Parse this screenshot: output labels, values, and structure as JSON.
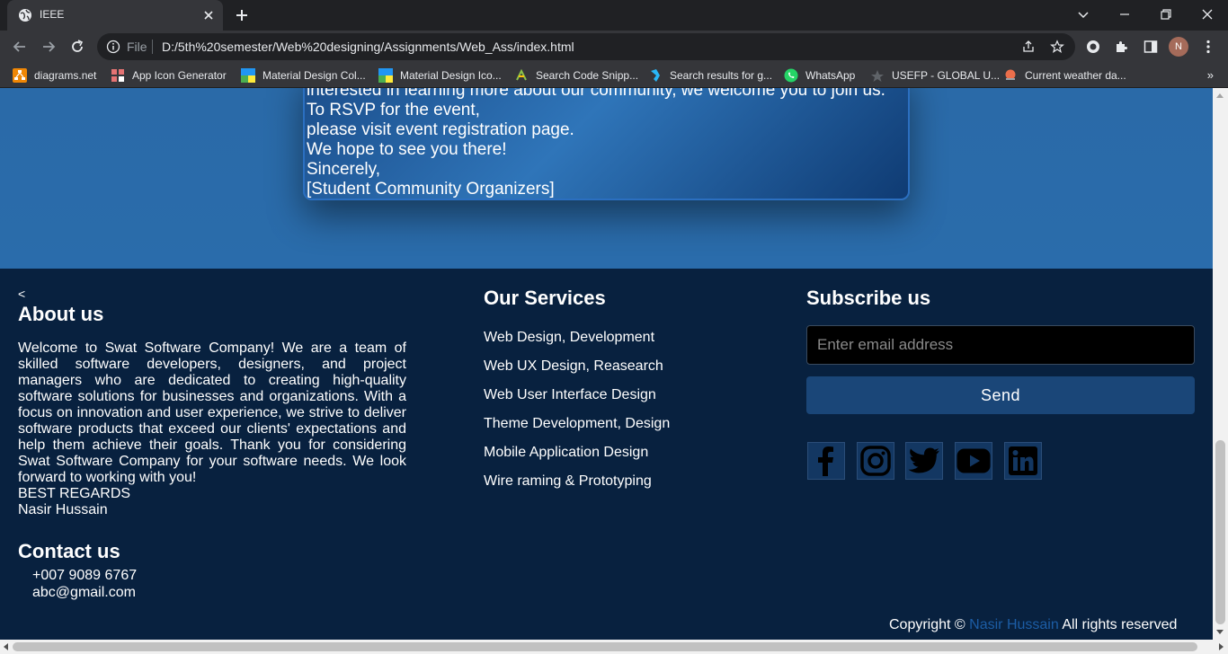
{
  "browser": {
    "tab_title": "IEEE",
    "omnibox_scheme": "File",
    "url": "D:/5th%20semester/Web%20designing/Assignments/Web_Ass/index.html",
    "profile_initial": "N",
    "bookmarks": [
      {
        "label": "diagrams.net",
        "icon": "diagrams-icon"
      },
      {
        "label": "App Icon Generator",
        "icon": "app-icon-generator-icon"
      },
      {
        "label": "Material Design Col...",
        "icon": "material-color-icon"
      },
      {
        "label": "Material Design Ico...",
        "icon": "material-icons-icon"
      },
      {
        "label": "Search Code Snipp...",
        "icon": "code-snippet-icon"
      },
      {
        "label": "Search results for g...",
        "icon": "search-results-icon"
      },
      {
        "label": "WhatsApp",
        "icon": "whatsapp-icon"
      },
      {
        "label": "USEFP - GLOBAL U...",
        "icon": "usefp-icon"
      },
      {
        "label": "Current weather da...",
        "icon": "weather-icon"
      }
    ],
    "bookmarks_overflow": "»"
  },
  "event_card": {
    "lines": [
      "interested in learning more about our community, we welcome you to join us.",
      "To RSVP for the event,",
      "please visit event registration page.",
      "We hope to see you there!",
      "Sincerely,",
      "[Student Community Organizers]"
    ]
  },
  "footer": {
    "stray_text": "<",
    "about": {
      "heading": "About us",
      "text": "Welcome to Swat Software Company! We are a team of skilled software developers, designers, and project managers who are dedicated to creating high-quality software solutions for businesses and organizations. With a focus on innovation and user experience, we strive to deliver software products that exceed our clients' expectations and help them achieve their goals. Thank you for considering Swat Software Company for your software needs. We look forward to working with you!",
      "regards": "BEST REGARDS",
      "name": "Nasir Hussain"
    },
    "contact": {
      "heading": "Contact us",
      "phone": "+007 9089 6767",
      "email": "abc@gmail.com"
    },
    "services": {
      "heading": "Our Services",
      "items": [
        "Web Design, Development",
        "Web UX Design, Reasearch",
        "Web User Interface Design",
        "Theme Development, Design",
        "Mobile Application Design",
        "Wire raming & Prototyping"
      ]
    },
    "subscribe": {
      "heading": "Subscribe us",
      "placeholder": "Enter email address",
      "button": "Send"
    },
    "social_icons": [
      "facebook-icon",
      "instagram-icon",
      "twitter-icon",
      "youtube-icon",
      "linkedin-icon"
    ],
    "copyright": {
      "prefix": "Copyright ©",
      "owner": "Nasir Hussain",
      "suffix": "All rights reserved"
    }
  },
  "colors": {
    "hero_blue": "#2a6cab",
    "footer_navy": "#08213f",
    "send_button": "#1a4678",
    "copyright_owner": "#1c5da5"
  }
}
